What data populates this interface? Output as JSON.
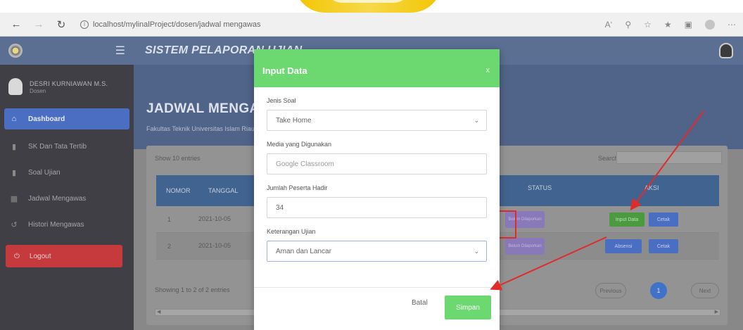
{
  "browser": {
    "url": "localhost/mylinalProject/dosen/jadwal mengawas",
    "back_icon": "arrow-left",
    "forward_icon": "arrow-right",
    "reload_icon": "reload",
    "toolbar_icons": [
      "read-aloud-icon",
      "zoom-icon",
      "favorite-add-icon",
      "favorites-icon",
      "collections-icon",
      "profile-icon",
      "more-icon"
    ]
  },
  "header": {
    "title": "SISTEM PELAPORAN UJIAN"
  },
  "sidebar": {
    "user_name": "DESRI KURNIAWAN M.S.",
    "user_role": "Dosen",
    "items": [
      {
        "label": "Dashboard",
        "icon": "home-icon"
      },
      {
        "label": "SK Dan Tata Tertib",
        "icon": "document-icon"
      },
      {
        "label": "Soal Ujian",
        "icon": "document-icon"
      },
      {
        "label": "Jadwal Mengawas",
        "icon": "calendar-icon"
      },
      {
        "label": "Histori Mengawas",
        "icon": "history-icon"
      }
    ],
    "logout_label": "Logout"
  },
  "page": {
    "title": "JADWAL MENGAWAS",
    "subtitle": "Fakultas Teknik Universitas Islam Riau"
  },
  "table": {
    "show_entries": "Show  10  entries",
    "search_label": "Search:",
    "headers": [
      "NOMOR",
      "TANGGAL",
      "STATUS",
      "AKSI"
    ],
    "rows": [
      {
        "no": "1",
        "date": "2021-10-05",
        "status": "Belum Dilaporkan",
        "actions": [
          "Input Data",
          "Cetak"
        ]
      },
      {
        "no": "2",
        "date": "2021-10-05",
        "status": "Belum Dilaporkan",
        "actions": [
          "Absensi",
          "Cetak"
        ]
      }
    ],
    "showing": "Showing 1 to 2 of 2 entries",
    "pagination": {
      "previous": "Previous",
      "current": "1",
      "next": "Next"
    }
  },
  "modal": {
    "title": "Input Data",
    "close": "x",
    "fields": [
      {
        "label": "Jenis Soal",
        "value": "Take Home",
        "type": "select"
      },
      {
        "label": "Media yang Digunakan",
        "value": "Google Classroom",
        "type": "text-placeholder"
      },
      {
        "label": "Jumlah Peserta Hadir",
        "value": "34",
        "type": "text"
      },
      {
        "label": "Keterangan Ujian",
        "value": "Aman dan Lancar",
        "type": "select"
      }
    ],
    "cancel_label": "Batal",
    "save_label": "Simpan"
  },
  "colors": {
    "header": "#5b6f93",
    "modal_accent": "#6bd96f",
    "annotation": "#e12b2b",
    "sidebar_active": "#4a6ec2",
    "logout": "#c63a3e"
  }
}
